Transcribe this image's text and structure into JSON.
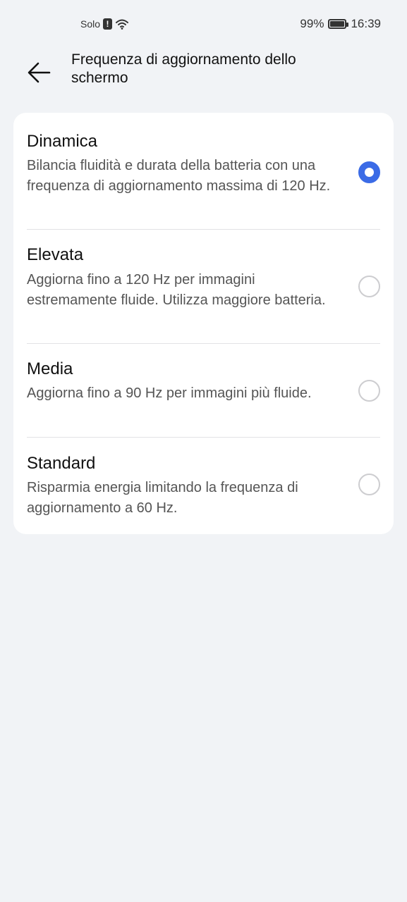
{
  "status_bar": {
    "carrier": "Solo",
    "sim_alert_glyph": "!",
    "battery_percent": "99%",
    "battery_level": 0.99,
    "time": "16:39",
    "icons": [
      "sim-alert-icon",
      "wifi-icon",
      "battery-icon"
    ]
  },
  "header": {
    "back_icon": "arrow-left-icon",
    "title": "Frequenza di aggiornamento dello schermo"
  },
  "options": [
    {
      "title": "Dinamica",
      "description": "Bilancia fluidità e durata della batteria con una frequenza di aggiornamento massima di 120 Hz.",
      "selected": true
    },
    {
      "title": "Elevata",
      "description": "Aggiorna fino a 120 Hz per immagini estremamente fluide. Utilizza maggiore batteria.",
      "selected": false
    },
    {
      "title": "Media",
      "description": "Aggiorna fino a 90 Hz per immagini più fluide.",
      "selected": false
    },
    {
      "title": "Standard",
      "description": "Risparmia energia limitando la frequenza di aggiornamento a 60 Hz.",
      "selected": false
    }
  ],
  "colors": {
    "background": "#f1f3f6",
    "card": "#ffffff",
    "accent": "#3b6be6",
    "secondary_text": "#555555"
  }
}
